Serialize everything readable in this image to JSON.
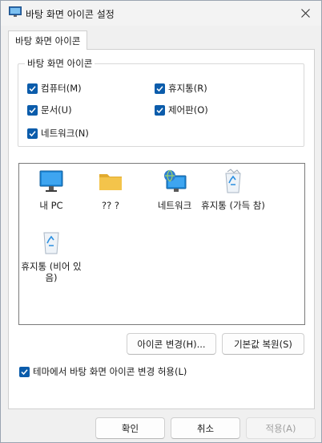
{
  "window": {
    "title": "바탕 화면 아이콘 설정"
  },
  "tab": {
    "label": "바탕 화면 아이콘"
  },
  "group": {
    "legend": "바탕 화면 아이콘",
    "checkboxes": [
      {
        "label": "컴퓨터(M)",
        "checked": true
      },
      {
        "label": "휴지통(R)",
        "checked": true
      },
      {
        "label": "문서(U)",
        "checked": true
      },
      {
        "label": "제어판(O)",
        "checked": true
      },
      {
        "label": "네트워크(N)",
        "checked": true
      }
    ]
  },
  "icons": [
    {
      "label": "내 PC",
      "icon": "monitor-icon"
    },
    {
      "label": "?? ?",
      "icon": "folder-icon"
    },
    {
      "label": "네트워크",
      "icon": "network-icon"
    },
    {
      "label": "휴지통 (가득 참)",
      "icon": "recycle-bin-full-icon"
    },
    {
      "label": "휴지통 (비어 있음)",
      "icon": "recycle-bin-empty-icon"
    }
  ],
  "buttons": {
    "change_icon": "아이콘 변경(H)...",
    "restore_default": "기본값 복원(S)",
    "ok": "확인",
    "cancel": "취소",
    "apply": "적용(A)"
  },
  "themes_checkbox": {
    "label": "테마에서 바탕 화면 아이콘 변경 허용(L)",
    "checked": true
  },
  "colors": {
    "accent": "#0b5cab",
    "monitor": "#1e88d8",
    "folder": "#f3c44b"
  }
}
